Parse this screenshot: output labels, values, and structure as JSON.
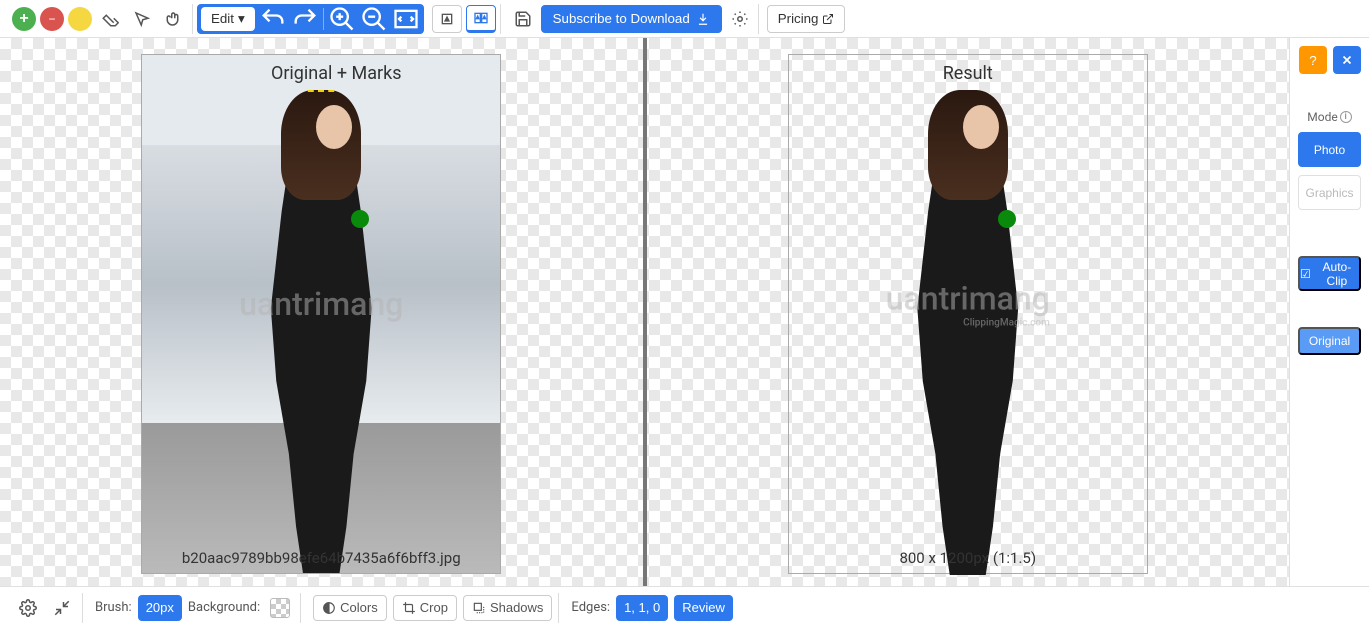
{
  "toolbar": {
    "edit_label": "Edit",
    "download_label": "Subscribe to Download",
    "pricing_label": "Pricing"
  },
  "panels": {
    "left_title": "Original + Marks",
    "right_title": "Result",
    "filename": "b20aac9789bb98efe64b7435a6f6bff3.jpg",
    "dimensions": "800 x 1200px (1:1.5)",
    "watermark": "uantrimang",
    "watermark_sub": "ClippingMagic.com"
  },
  "sidebar": {
    "mode_label": "Mode",
    "photo_label": "Photo",
    "graphics_label": "Graphics",
    "autoclip_label": "Auto-Clip",
    "original_label": "Original"
  },
  "bottombar": {
    "brush_label": "Brush:",
    "brush_value": "20px",
    "background_label": "Background:",
    "colors_label": "Colors",
    "crop_label": "Crop",
    "shadows_label": "Shadows",
    "edges_label": "Edges:",
    "edges_value": "1, 1, 0",
    "review_label": "Review"
  }
}
